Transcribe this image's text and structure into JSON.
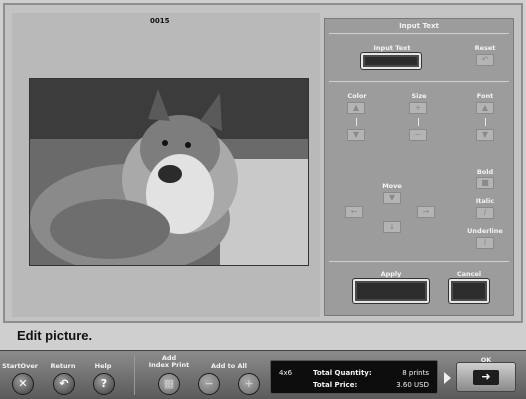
{
  "frame": {
    "number": "0015"
  },
  "panel": {
    "title": "Input Text",
    "input_text_label": "Input Text",
    "reset_label": "Reset",
    "color_label": "Color",
    "size_label": "Size",
    "font_label": "Font",
    "bold_label": "Bold",
    "italic_label": "Italic",
    "underline_label": "Underline",
    "move_label": "Move",
    "apply_label": "Apply",
    "cancel_label": "Cancel"
  },
  "status": {
    "text": "Edit picture."
  },
  "toolbar": {
    "startover_label": "StartOver",
    "return_label": "Return",
    "help_label": "Help",
    "add_index_print_label": "Add\nIndex Print",
    "add_to_all_label": "Add to All",
    "ok_label": "OK"
  },
  "order": {
    "size": "4x6",
    "total_quantity_label": "Total Quantity:",
    "total_quantity_value": "8 prints",
    "total_price_label": "Total Price:",
    "total_price_value": "3.60 USD"
  },
  "icons": {
    "startover": "close-icon",
    "return": "undo-icon",
    "help": "help-icon",
    "index_print": "grid-icon",
    "minus": "minus-icon",
    "plus": "plus-icon",
    "ok": "arrow-right-icon"
  }
}
